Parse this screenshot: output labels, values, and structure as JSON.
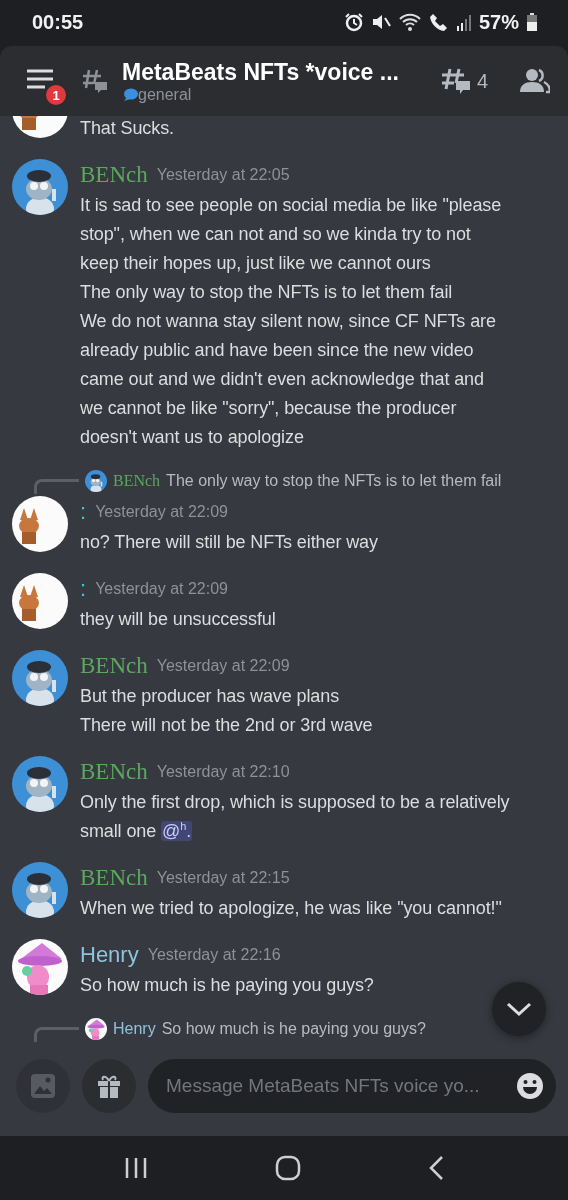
{
  "status_bar": {
    "time": "00:55",
    "battery": "57%"
  },
  "header": {
    "menu_badge": "1",
    "title": "MetaBeats NFTs *voice ...",
    "channel": "general",
    "thread_count": "4"
  },
  "messages": [
    {
      "kind": "continued",
      "lines": [
        "That Sucks."
      ]
    },
    {
      "kind": "message",
      "author": "BENch",
      "color": "#5aa85e",
      "time": "Yesterday at 22:05",
      "lines": [
        "It is sad to see people on social media be like \"please",
        "stop\", when we can not and so we kinda try to not",
        "keep their hopes up, just like we cannot ours",
        "The only way to stop the NFTs is to let them fail",
        "We do not wanna stay silent now, since CF NFTs are",
        "already public and have been since the new video",
        "came out and we didn't even acknowledge that and",
        "we cannot be like \"sorry\", because the producer",
        "doesn't want us to apologize"
      ]
    },
    {
      "kind": "message",
      "reply": {
        "author": "BENch",
        "color": "#5aa85e",
        "text": "The only way to stop the NFTs is to let them fail"
      },
      "author": ":",
      "color": "#2fd0cc",
      "time": "Yesterday at 22:09",
      "lines": [
        "no? There will still be NFTs either way"
      ]
    },
    {
      "kind": "message",
      "author": ":",
      "color": "#2fd0cc",
      "time": "Yesterday at 22:09",
      "lines": [
        "they will be unsuccessful"
      ]
    },
    {
      "kind": "message",
      "author": "BENch",
      "color": "#5aa85e",
      "time": "Yesterday at 22:09",
      "lines": [
        "But the producer has wave plans",
        "There will not be the 2nd or 3rd wave"
      ]
    },
    {
      "kind": "message",
      "author": "BENch",
      "color": "#5aa85e",
      "time": "Yesterday at 22:10",
      "lines": [
        "Only the first drop, which is supposed to be a relatively",
        "small one"
      ],
      "mention": "@$^{h}$."
    },
    {
      "kind": "message",
      "author": "BENch",
      "color": "#5aa85e",
      "time": "Yesterday at 22:15",
      "lines": [
        "When we tried to apologize, he was like \"you cannot!\""
      ]
    },
    {
      "kind": "message",
      "author": "Henry",
      "color": "#8ec3dc",
      "time": "Yesterday at 22:16",
      "lines": [
        "So how much is he paying you guys?"
      ]
    },
    {
      "kind": "reply_only",
      "reply": {
        "author": "Henry",
        "color": "#8ec3dc",
        "text": "So how much is he paying you guys?"
      }
    }
  ],
  "composer": {
    "placeholder": "Message MetaBeats NFTs voice yo..."
  }
}
